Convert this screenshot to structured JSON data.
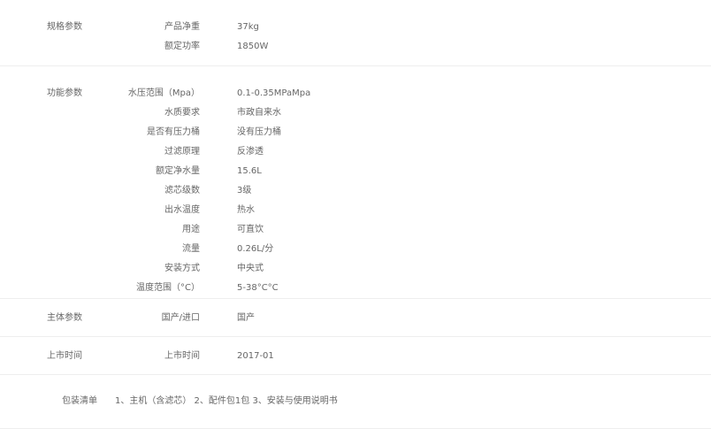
{
  "sections": [
    {
      "title": "规格参数",
      "rows": [
        {
          "key": "产品净重",
          "value": "37kg"
        },
        {
          "key": "额定功率",
          "value": "1850W"
        }
      ]
    },
    {
      "title": "功能参数",
      "rows": [
        {
          "key": "水压范围（Mpa）",
          "value": "0.1-0.35MPaMpa"
        },
        {
          "key": "水质要求",
          "value": "市政自来水"
        },
        {
          "key": "是否有压力桶",
          "value": "没有压力桶"
        },
        {
          "key": "过滤原理",
          "value": "反渗透"
        },
        {
          "key": "额定净水量",
          "value": "15.6L"
        },
        {
          "key": "滤芯级数",
          "value": "3级"
        },
        {
          "key": "出水温度",
          "value": "热水"
        },
        {
          "key": "用途",
          "value": "可直饮"
        },
        {
          "key": "流量",
          "value": "0.26L/分"
        },
        {
          "key": "安装方式",
          "value": "中央式"
        },
        {
          "key": "温度范围（°C）",
          "value": "5-38°C°C"
        }
      ]
    },
    {
      "title": "主体参数",
      "rows": [
        {
          "key": "国产/进口",
          "value": "国产"
        }
      ]
    },
    {
      "title": "上市时间",
      "rows": [
        {
          "key": "上市时间",
          "value": "2017-01"
        }
      ]
    }
  ],
  "packing": {
    "title": "包装清单",
    "content": "1、主机（含滤芯） 2、配件包1包 3、安装与使用说明书"
  }
}
